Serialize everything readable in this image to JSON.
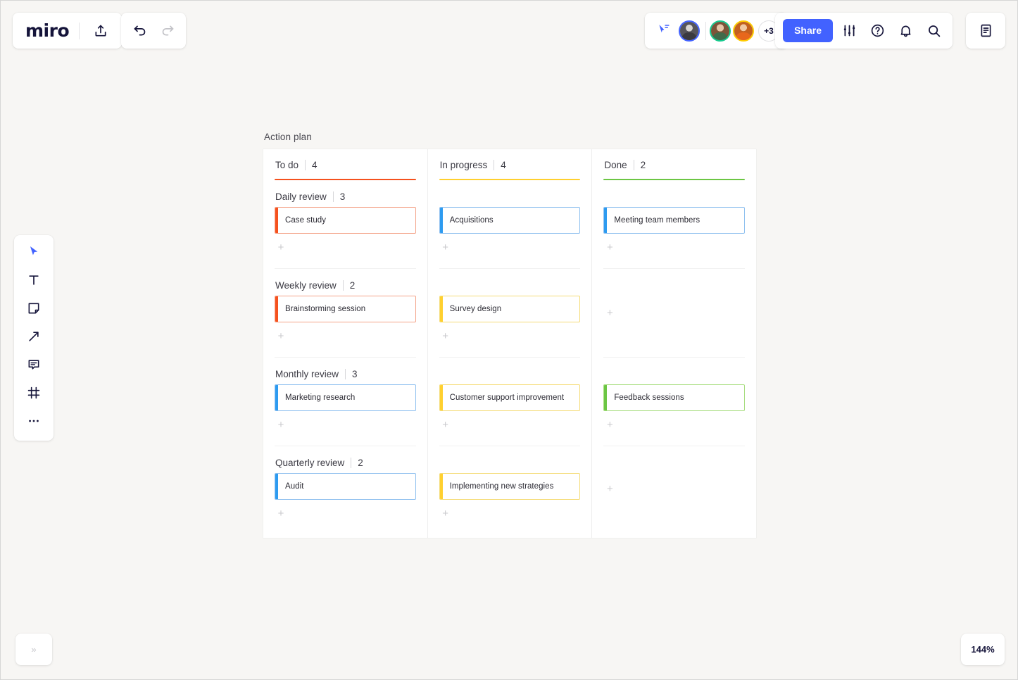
{
  "app": {
    "name": "miro",
    "zoom_level": "144%"
  },
  "toolbar_top": {
    "logo_text": "miro",
    "upload_label": "upload-icon",
    "undo_label": "undo-icon",
    "redo_label": "redo-icon",
    "cursor_share_label": "cursor-share-icon",
    "avatars_overflow": "+3",
    "share_label": "Share",
    "settings_label": "settings-sliders-icon",
    "help_label": "help-icon",
    "notifications_label": "bell-icon",
    "search_label": "search-icon",
    "notes_panel_label": "notes-panel-icon"
  },
  "toolbar_left": {
    "tools": [
      {
        "name": "select-tool",
        "icon": "cursor-icon",
        "active": true
      },
      {
        "name": "text-tool",
        "icon": "text-icon",
        "active": false
      },
      {
        "name": "sticky-note-tool",
        "icon": "sticky-note-icon",
        "active": false
      },
      {
        "name": "arrow-tool",
        "icon": "arrow-icon",
        "active": false
      },
      {
        "name": "comment-tool",
        "icon": "comment-icon",
        "active": false
      },
      {
        "name": "frame-tool",
        "icon": "frame-icon",
        "active": false
      },
      {
        "name": "more-tools",
        "icon": "ellipsis-icon",
        "active": false
      }
    ]
  },
  "board": {
    "frame_title": "Action plan",
    "add_button_label": "+",
    "columns": [
      {
        "label": "To do",
        "count": "4",
        "color": "#f5511e"
      },
      {
        "label": "In progress",
        "count": "4",
        "color": "#ffd02f"
      },
      {
        "label": "Done",
        "count": "2",
        "color": "#6cc644"
      }
    ],
    "rows": [
      {
        "label": "Daily review",
        "count": "3",
        "cells": [
          {
            "card": "Case study",
            "accent": "orange"
          },
          {
            "card": "Acquisitions",
            "accent": "blue"
          },
          {
            "card": "Meeting team members",
            "accent": "blue"
          }
        ]
      },
      {
        "label": "Weekly review",
        "count": "2",
        "cells": [
          {
            "card": "Brainstorming session",
            "accent": "orange"
          },
          {
            "card": "Survey design",
            "accent": "yellow"
          },
          {
            "card": null,
            "accent": null
          }
        ]
      },
      {
        "label": "Monthly review",
        "count": "3",
        "cells": [
          {
            "card": "Marketing research",
            "accent": "blue"
          },
          {
            "card": "Customer support improvement",
            "accent": "yellow"
          },
          {
            "card": "Feedback sessions",
            "accent": "green"
          }
        ]
      },
      {
        "label": "Quarterly review",
        "count": "2",
        "cells": [
          {
            "card": "Audit",
            "accent": "blue"
          },
          {
            "card": "Implementing new strategies",
            "accent": "yellow"
          },
          {
            "card": null,
            "accent": null
          }
        ]
      }
    ]
  },
  "bottom": {
    "expand_panel_label": "»",
    "zoom_label": "144%"
  }
}
